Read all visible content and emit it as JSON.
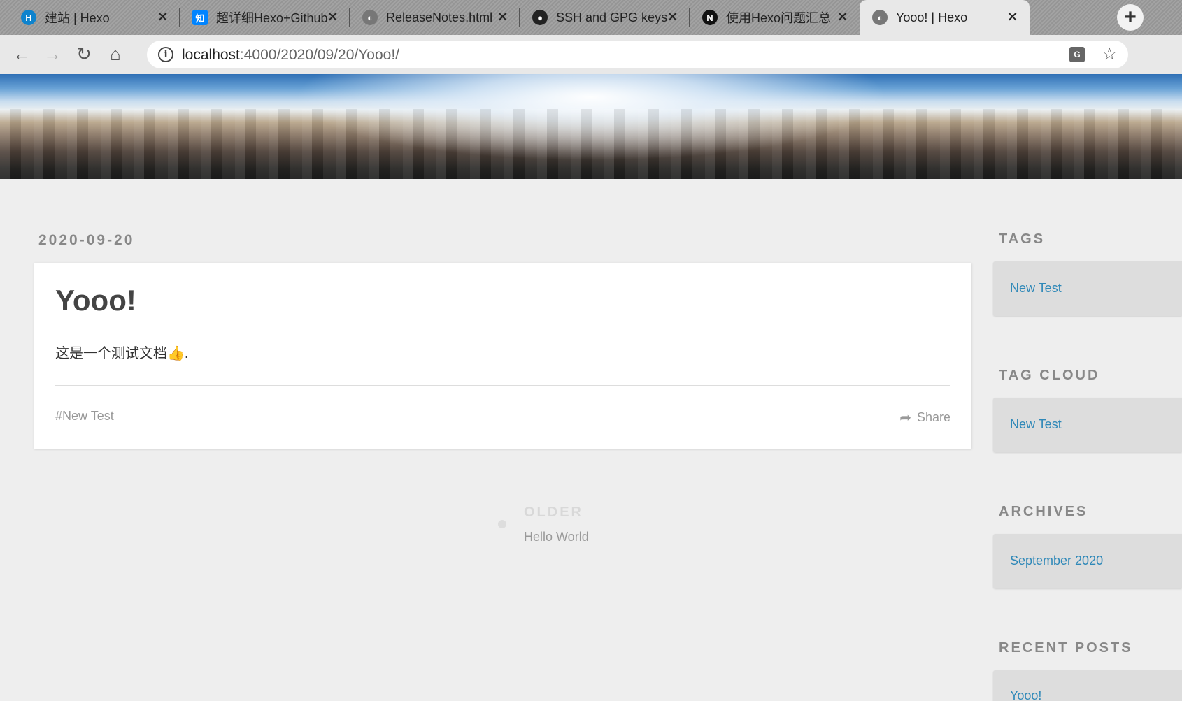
{
  "browser": {
    "tabs": [
      {
        "title": "建站 | Hexo",
        "favicon": "hexo-icon",
        "color": "#0e83cd",
        "glyph": "H"
      },
      {
        "title": "超详细Hexo+Github",
        "favicon": "zhihu-icon",
        "color": "#0084ff",
        "glyph": "知"
      },
      {
        "title": "ReleaseNotes.html",
        "favicon": "globe-icon",
        "color": "#666666",
        "glyph": ""
      },
      {
        "title": "SSH and GPG keys",
        "favicon": "github-icon",
        "color": "#222222",
        "glyph": ""
      },
      {
        "title": "使用Hexo问题汇总",
        "favicon": "notion-icon",
        "color": "#111111",
        "glyph": "N"
      },
      {
        "title": "Yooo! | Hexo",
        "favicon": "globe-icon",
        "color": "#666666",
        "glyph": ""
      }
    ],
    "url_host": "localhost",
    "url_path": ":4000/2020/09/20/Yooo!/"
  },
  "post": {
    "date": "2020-09-20",
    "title": "Yooo!",
    "body": "这是一个测试文档",
    "body_emoji": "👍",
    "body_tail": ".",
    "tag": "#New Test",
    "share_label": "Share"
  },
  "pager": {
    "older_label": "OLDER",
    "older_title": "Hello World"
  },
  "sidebar": {
    "tags_title": "TAGS",
    "tags_link": "New Test",
    "tagcloud_title": "TAG CLOUD",
    "tagcloud_link": "New Test",
    "archives_title": "ARCHIVES",
    "archives_link": "September 2020",
    "recent_title": "RECENT POSTS",
    "recent_link": "Yooo!"
  },
  "colors": {
    "link": "#2e88b8",
    "background": "#eeeeee"
  }
}
